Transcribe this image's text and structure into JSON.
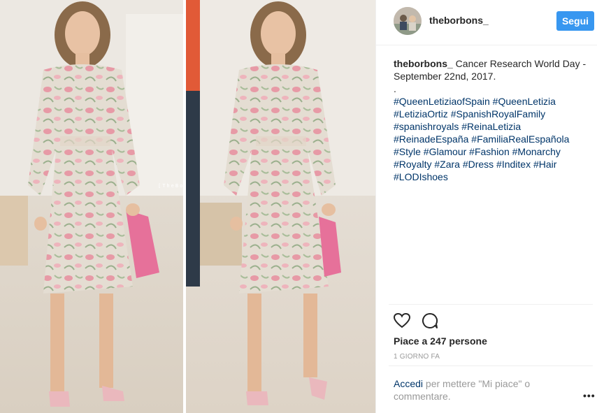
{
  "post": {
    "username": "theborbons_",
    "follow_label": "Segui",
    "caption_user": "theborbons_",
    "caption_text": "Cancer Research World Day - September 22nd, 2017.",
    "caption_dot": ".",
    "hashtags": "#QueenLetiziaofSpain #QueenLetizia #LetiziaOrtiz #SpanishRoyalFamily #spanishroyals #ReinaLetizia #ReinadeEspaña #FamiliaRealEspañola #Style #Glamour #Fashion #Monarchy #Royalty #Zara #Dress #Inditex #Hair #LODIshoes",
    "likes": "Piace a 247 persone",
    "time": "1 giorno fa",
    "comment_link": "Accedi",
    "comment_rest": " per mettere \"Mi piace\" o commentare.",
    "more": "•••"
  },
  "watermark": "[TheBorbons]",
  "icons": {
    "like": "heart-icon",
    "comment": "comment-icon",
    "more": "more-options-icon"
  },
  "colors": {
    "follow_button": "#3897f0",
    "hashtag": "#003569",
    "meta_text": "#999999",
    "dress_pink": "#e79aa6",
    "clutch_pink": "#e6719a"
  }
}
